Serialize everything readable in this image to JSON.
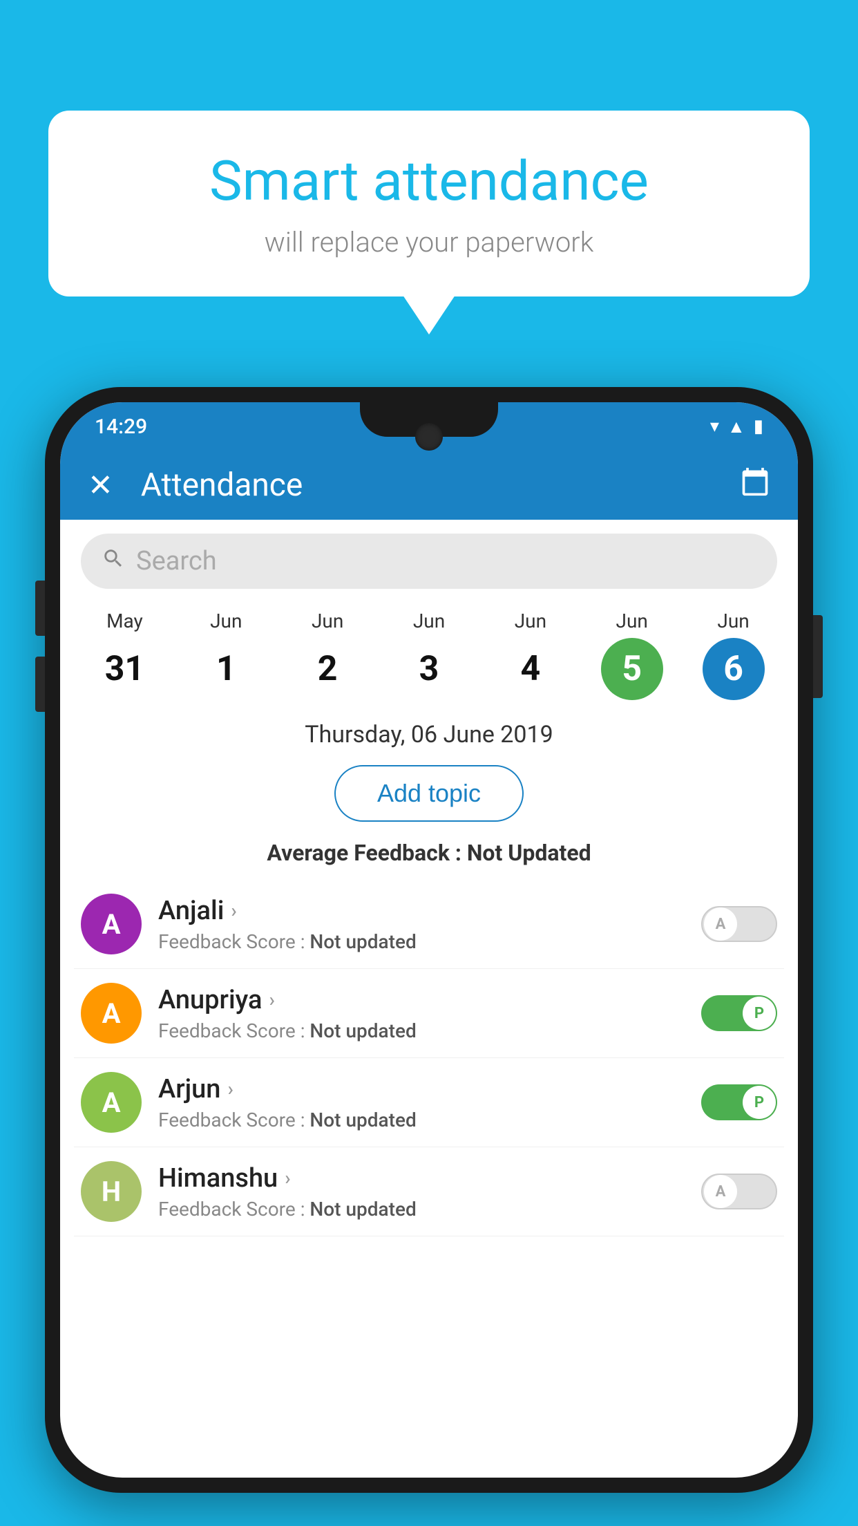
{
  "background_color": "#1ab8e8",
  "bubble": {
    "title": "Smart attendance",
    "subtitle": "will replace your paperwork"
  },
  "status_bar": {
    "time": "14:29"
  },
  "app_bar": {
    "title": "Attendance",
    "close_icon": "✕",
    "calendar_icon": "📅"
  },
  "search": {
    "placeholder": "Search"
  },
  "calendar": {
    "days": [
      {
        "month": "May",
        "date": "31",
        "style": "normal"
      },
      {
        "month": "Jun",
        "date": "1",
        "style": "normal"
      },
      {
        "month": "Jun",
        "date": "2",
        "style": "normal"
      },
      {
        "month": "Jun",
        "date": "3",
        "style": "normal"
      },
      {
        "month": "Jun",
        "date": "4",
        "style": "normal"
      },
      {
        "month": "Jun",
        "date": "5",
        "style": "today"
      },
      {
        "month": "Jun",
        "date": "6",
        "style": "selected"
      }
    ]
  },
  "selected_date": "Thursday, 06 June 2019",
  "add_topic_label": "Add topic",
  "avg_feedback_label": "Average Feedback :",
  "avg_feedback_value": "Not Updated",
  "students": [
    {
      "name": "Anjali",
      "avatar_letter": "A",
      "avatar_color": "#9c27b0",
      "feedback_label": "Feedback Score :",
      "feedback_value": "Not updated",
      "toggle": "off",
      "toggle_letter": "A"
    },
    {
      "name": "Anupriya",
      "avatar_letter": "A",
      "avatar_color": "#ff9800",
      "feedback_label": "Feedback Score :",
      "feedback_value": "Not updated",
      "toggle": "on",
      "toggle_letter": "P"
    },
    {
      "name": "Arjun",
      "avatar_letter": "A",
      "avatar_color": "#8bc34a",
      "feedback_label": "Feedback Score :",
      "feedback_value": "Not updated",
      "toggle": "on",
      "toggle_letter": "P"
    },
    {
      "name": "Himanshu",
      "avatar_letter": "H",
      "avatar_color": "#aac36a",
      "feedback_label": "Feedback Score :",
      "feedback_value": "Not updated",
      "toggle": "off",
      "toggle_letter": "A"
    }
  ]
}
